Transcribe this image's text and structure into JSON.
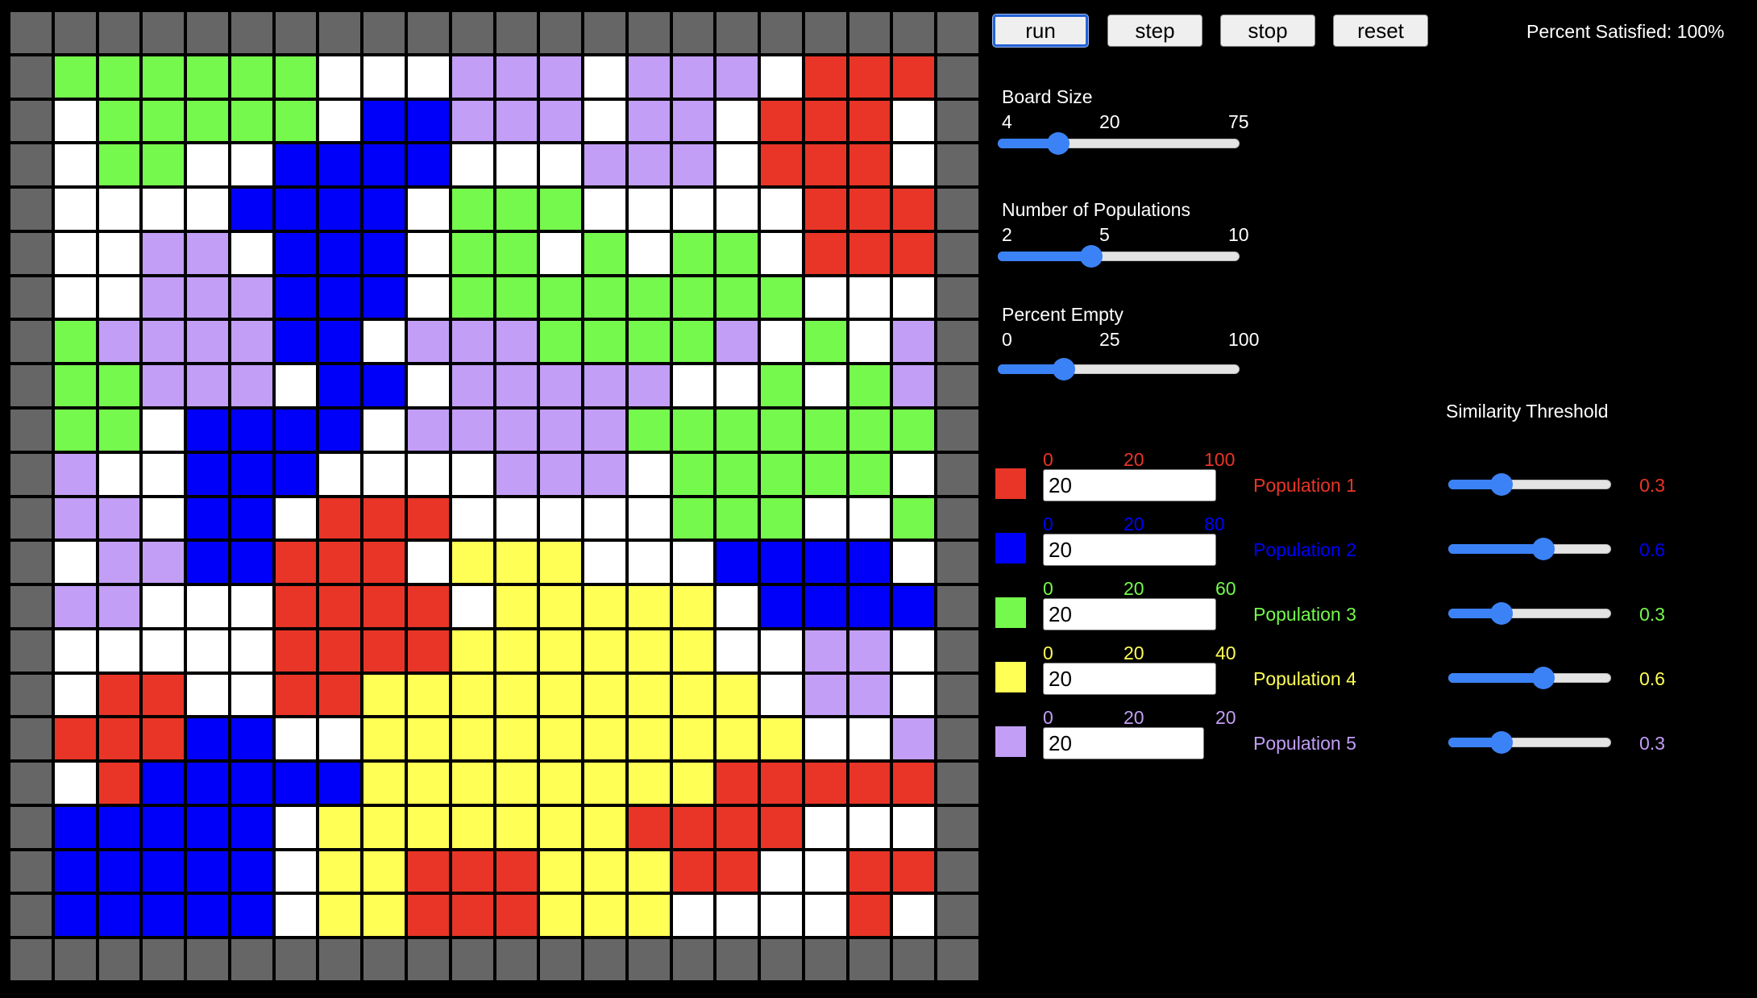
{
  "buttons": {
    "run": "run",
    "step": "step",
    "stop": "stop",
    "reset": "reset"
  },
  "status": {
    "percent_satisfied": "Percent Satisfied: 100%"
  },
  "colors": {
    "border": "#666666",
    "empty": "#ffffff",
    "population_1": "#e83527",
    "population_2": "#0000fa",
    "population_3": "#75f94c",
    "population_4": "#ffff55",
    "population_5": "#c29ef7",
    "slider_accent": "#3b82f6"
  },
  "board_size": {
    "label": "Board Size",
    "min": "4",
    "value": "20",
    "max": "75",
    "level": 0.225
  },
  "num_populations": {
    "label": "Number of Populations",
    "min": "2",
    "value": "5",
    "max": "10",
    "level": 0.375
  },
  "percent_empty": {
    "label": "Percent Empty",
    "min": "0",
    "value": "25",
    "max": "100",
    "level": 0.25
  },
  "similarity_threshold_label": "Similarity Threshold",
  "populations": [
    {
      "name": "Population 1",
      "color": "#e83527",
      "min": "0",
      "mid": "20",
      "max": "100",
      "count": "20",
      "threshold": "0.3",
      "threshold_level": 0.3
    },
    {
      "name": "Population 2",
      "color": "#0000fa",
      "min": "0",
      "mid": "20",
      "max": "80",
      "count": "20",
      "threshold": "0.6",
      "threshold_level": 0.6
    },
    {
      "name": "Population 3",
      "color": "#75f94c",
      "min": "0",
      "mid": "20",
      "max": "60",
      "count": "20",
      "threshold": "0.3",
      "threshold_level": 0.3
    },
    {
      "name": "Population 4",
      "color": "#ffff55",
      "min": "0",
      "mid": "20",
      "max": "40",
      "count": "20",
      "threshold": "0.6",
      "threshold_level": 0.6
    },
    {
      "name": "Population 5",
      "color": "#c29ef7",
      "min": "0",
      "mid": "20",
      "max": "20",
      "count": "20",
      "threshold": "0.3",
      "threshold_level": 0.3
    }
  ],
  "board": {
    "legend": "B=border, W=empty, 1-5=population index",
    "rows": [
      "BBBBBBBBBBBBBBBBBBBBBB",
      "B333333WWW555W555W111B",
      "BW33333W22555W55W111WB",
      "BW33WW2222WWW555W111IB",
      "BWWWW2222W333WWWWW111B",
      "BWW55W222W33W3W33W111B",
      "BWW5552 22W33333333WWW5B",
      "B35555 22W55533335W3W55B",
      "B33555W22W55555WW3W355B",
      "B33W2222W555553333333B",
      "B5WW222WWWW555W33333B",
      "B55W22W111WWWWW333WW3B",
      "BW5522111W444WWW2222B",
      "B55WWW1111W44444W2222B",
      "BWWWWW1111444444WW55B",
      "BW11WW11444444444W55B",
      "B111 22WW4444444444WW55B",
      "BW1222224444444 4111115B",
      "B22222W44444441111WB",
      "B22222W4411144411WW11B",
      "B22222W44111444WWWW1B",
      "BBBBBBBBBBBBBBBBBBBBBB"
    ]
  }
}
